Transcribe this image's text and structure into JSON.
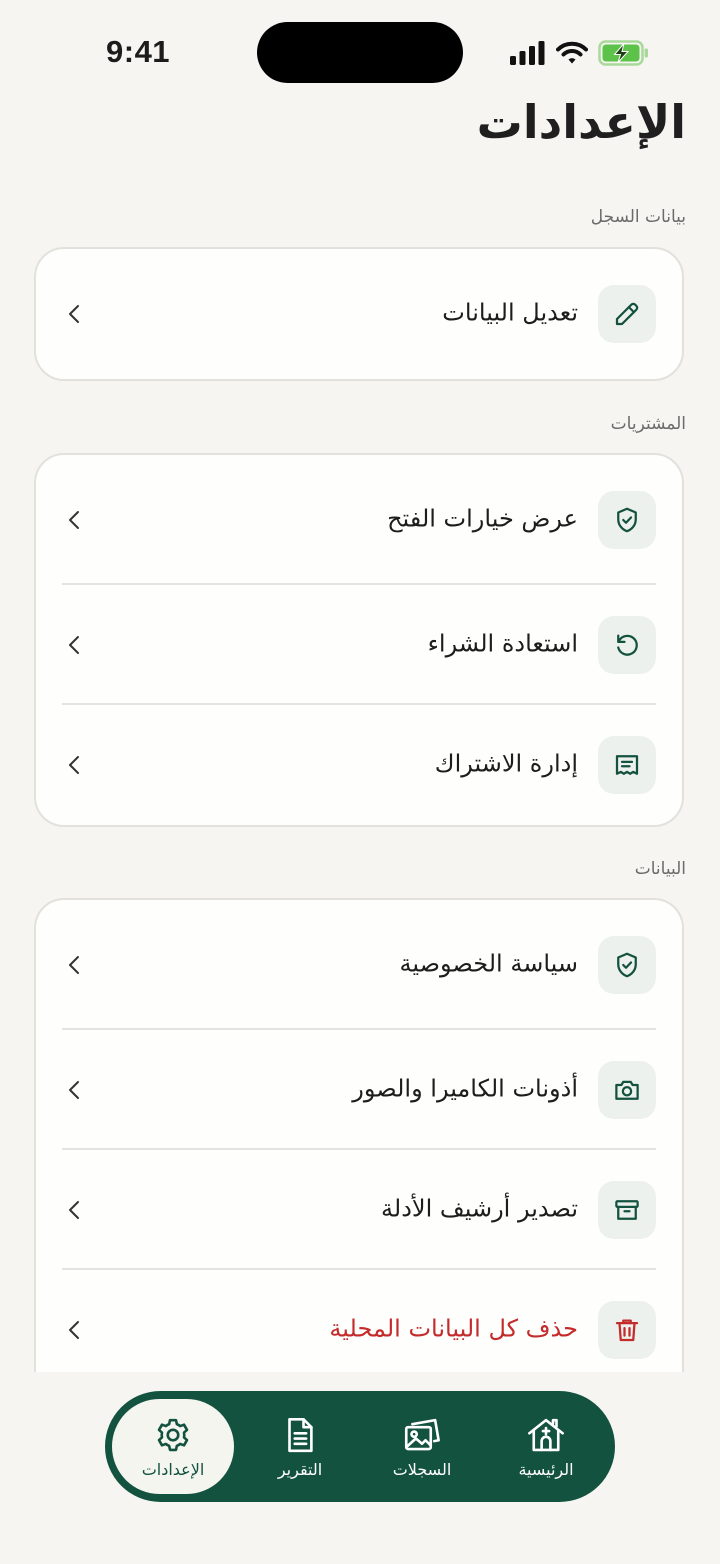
{
  "status_bar": {
    "time": "9:41"
  },
  "page_title": "الإعدادات",
  "sections": [
    {
      "label": "بيانات السجل",
      "items": [
        {
          "label": "تعديل البيانات",
          "icon": "pencil-icon"
        }
      ]
    },
    {
      "label": "المشتريات",
      "items": [
        {
          "label": "عرض خيارات الفتح",
          "icon": "shield-check-icon"
        },
        {
          "label": "استعادة الشراء",
          "icon": "restore-icon"
        },
        {
          "label": "إدارة الاشتراك",
          "icon": "receipt-icon"
        }
      ]
    },
    {
      "label": "البيانات",
      "items": [
        {
          "label": "سياسة الخصوصية",
          "icon": "shield-check-icon"
        },
        {
          "label": "أذونات الكاميرا والصور",
          "icon": "camera-icon"
        },
        {
          "label": "تصدير أرشيف الأدلة",
          "icon": "archive-icon"
        },
        {
          "label": "حذف كل البيانات المحلية",
          "icon": "trash-icon",
          "color": "#c42b2b"
        }
      ]
    }
  ],
  "tab_bar": {
    "tabs": [
      {
        "label": "الإعدادات",
        "icon": "gear-icon",
        "active": true
      },
      {
        "label": "التقرير",
        "icon": "document-icon"
      },
      {
        "label": "السجلات",
        "icon": "photos-icon"
      },
      {
        "label": "الرئيسية",
        "icon": "home-icon"
      }
    ]
  },
  "colors": {
    "accent": "#145240",
    "background": "#f6f5f1",
    "card": "#fefefd",
    "danger": "#c42b2b",
    "icon_bg": "#edf1ee"
  }
}
